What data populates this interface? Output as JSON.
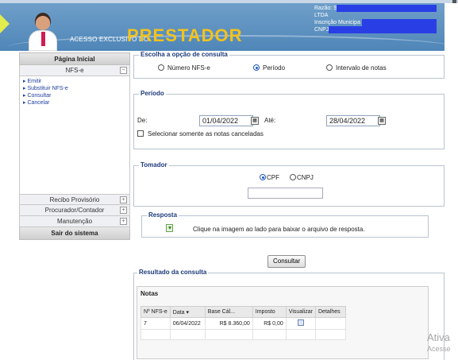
{
  "header": {
    "brand_small": "ACESSO EXCLUSIVO DO",
    "brand_big": "PRESTADOR",
    "info": {
      "razao": "Razão: S",
      "ltda": "LTDA",
      "inscricao": "Inscrição Municipa",
      "cnpj": "CNPJ:"
    }
  },
  "sidebar": {
    "home": "Página Inicial",
    "nfse_section": "NFS-e",
    "links": [
      "Emitir",
      "Substituir NFS-e",
      "Consultar",
      "Cancelar"
    ],
    "recibo": "Recibo Provisório",
    "procurador": "Procurador/Contador",
    "manutencao": "Manutenção",
    "logout": "Sair do sistema"
  },
  "consulta": {
    "legend": "Escolha a opção de consulta",
    "options": [
      "Número NFS-e",
      "Período",
      "Intervalo de notas"
    ],
    "selected": "Período"
  },
  "periodo": {
    "legend": "Período",
    "de_label": "De:",
    "de_value": "01/04/2022",
    "ate_label": "Até:",
    "ate_value": "28/04/2022",
    "checkbox_label": "Selecionar somente as notas canceladas"
  },
  "tomador": {
    "legend": "Tomador",
    "cpf": "CPF",
    "cnpj": "CNPJ",
    "selected": "CPF"
  },
  "resposta": {
    "legend": "Resposta",
    "text": "Clique na imagem ao lado para baixar o arquivo de resposta."
  },
  "consultar_button": "Consultar",
  "resultado": {
    "legend": "Resultado da consulta",
    "grid_title": "Notas",
    "columns": [
      "Nº NFS-e",
      "Data ▾",
      "Base Cál...",
      "Imposto",
      "Visualizar",
      "Detalhes"
    ],
    "rows": [
      {
        "numero": "7",
        "data": "06/04/2022",
        "base": "R$ 8.360,00",
        "imposto": "R$ 0,00"
      }
    ]
  },
  "watermark": {
    "line1": "Ativa",
    "line2": "Acesse"
  },
  "colors": {
    "header": "#4f86b8",
    "brand": "#f3c21c",
    "redaction": "#2a3ee6",
    "link": "#1f3e9c"
  }
}
